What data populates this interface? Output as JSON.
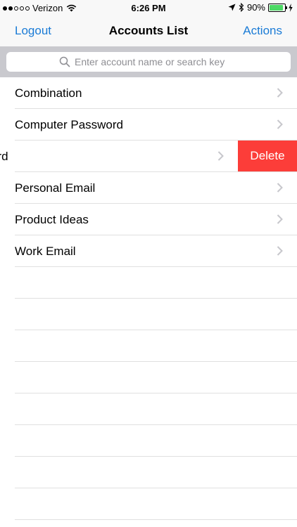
{
  "status_bar": {
    "carrier": "Verizon",
    "time": "6:26 PM",
    "battery_percent": "90%",
    "battery_level": 0.9,
    "signal_bars_filled": 2,
    "signal_bars_total": 5
  },
  "nav": {
    "left_label": "Logout",
    "title": "Accounts List",
    "right_label": "Actions"
  },
  "search": {
    "placeholder": "Enter account name or search key"
  },
  "accounts": [
    {
      "label": "Combination"
    },
    {
      "label": "Computer Password"
    },
    {
      "label": "Password",
      "swiped": true
    },
    {
      "label": "Personal Email"
    },
    {
      "label": "Product Ideas"
    },
    {
      "label": "Work Email"
    }
  ],
  "row_actions": {
    "delete_label": "Delete"
  },
  "colors": {
    "accent": "#1a7bd6",
    "delete": "#fc3d39",
    "battery": "#4cd964"
  }
}
